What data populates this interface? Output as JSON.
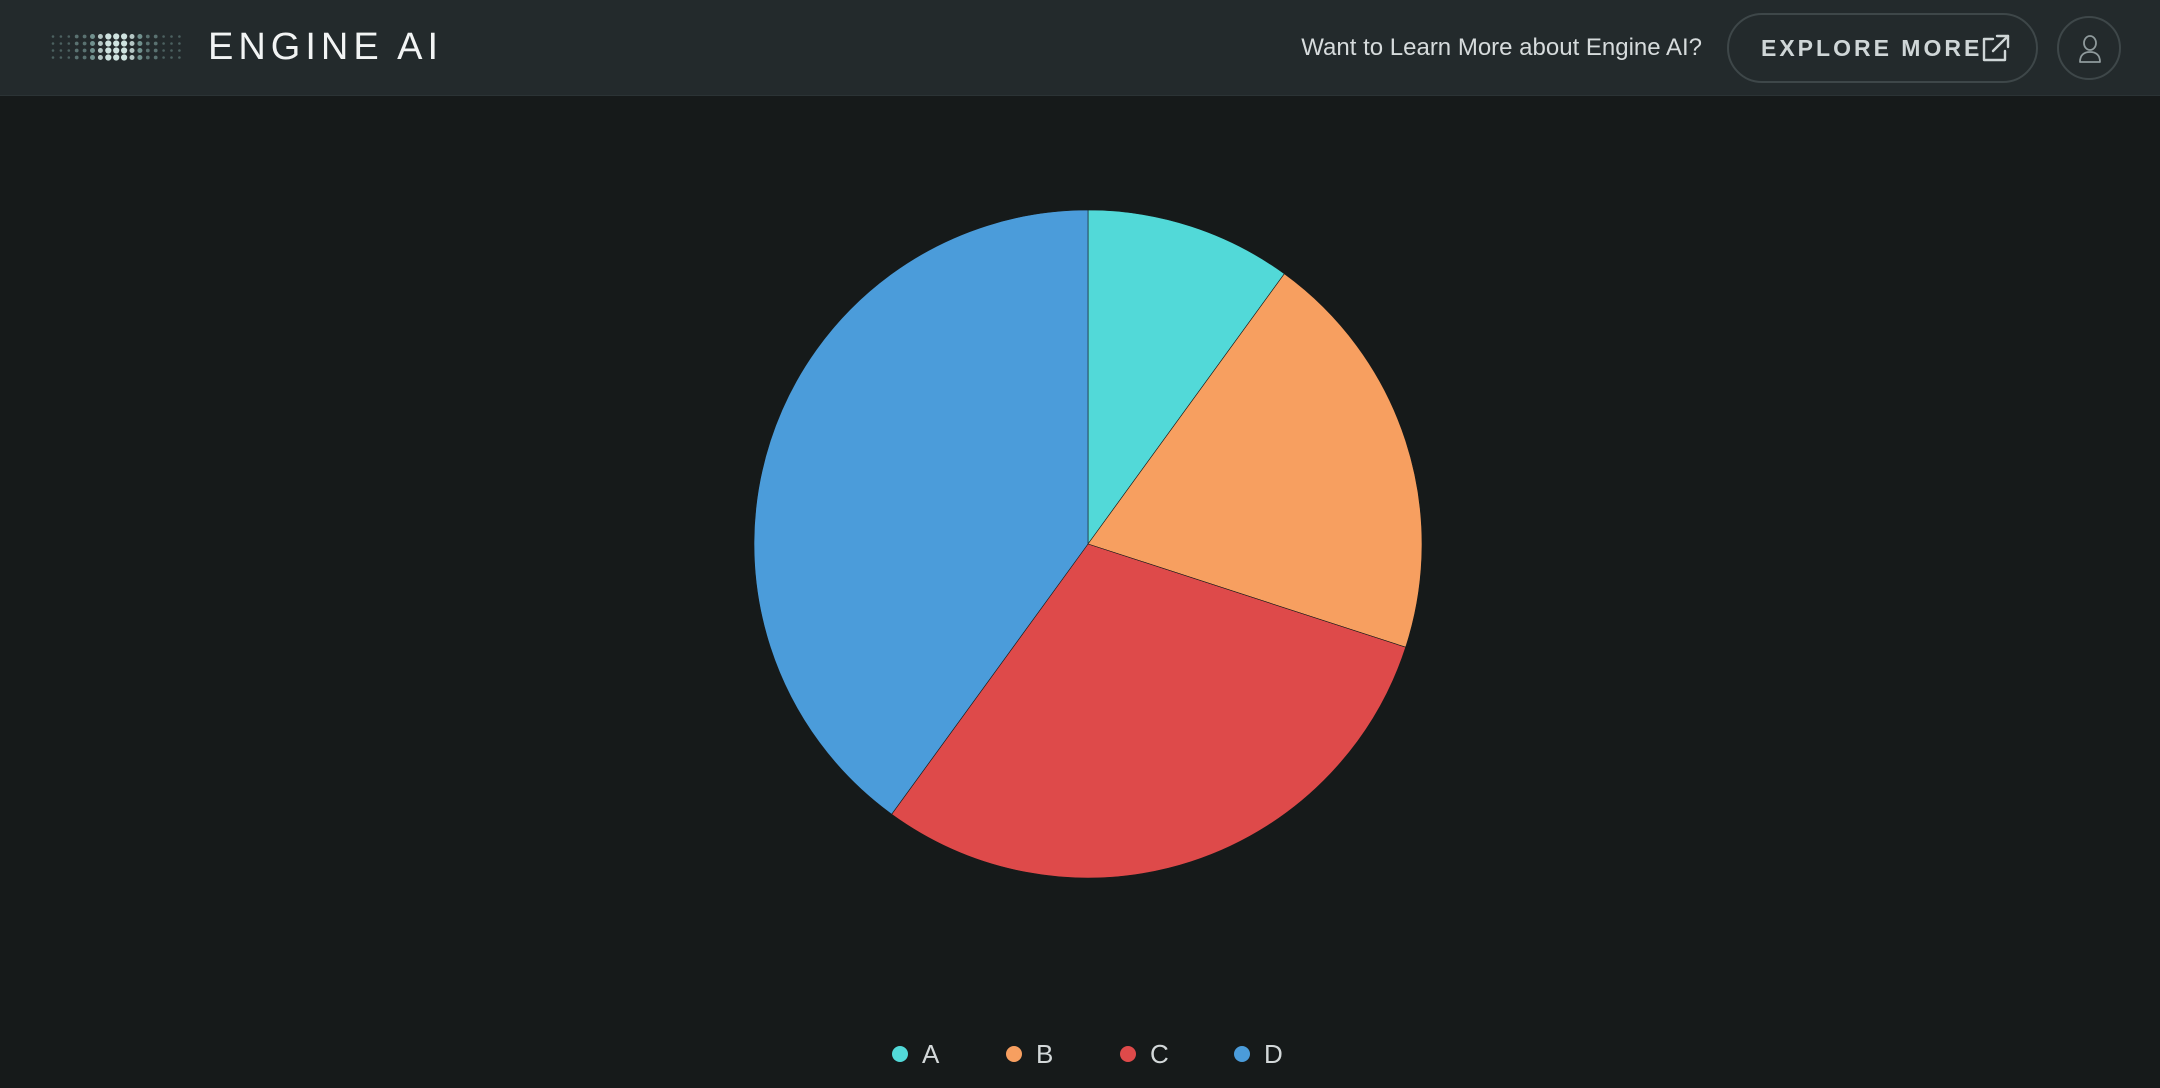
{
  "header": {
    "brand": "ENGINE AI",
    "promo_text": "Want to Learn More about Engine AI?",
    "explore_label": "EXPLORE MORE",
    "explore_icon": "external-link-icon",
    "user_icon": "user-icon",
    "logo_icon": "dot-matrix-logo-icon"
  },
  "colors": {
    "background": "#161a1a",
    "header_bg": "#232a2c",
    "A": "#52d9d8",
    "B": "#f79f60",
    "C": "#de4a4a",
    "D": "#4b9cda"
  },
  "chart_data": {
    "type": "pie",
    "title": "",
    "categories": [
      "A",
      "B",
      "C",
      "D"
    ],
    "values": [
      10,
      20,
      30,
      40
    ],
    "colors": [
      "#52d9d8",
      "#f79f60",
      "#de4a4a",
      "#4b9cda"
    ],
    "start_angle": "top (12 o'clock)",
    "direction": "clockwise",
    "legend": {
      "position": "bottom-center",
      "items": [
        "A",
        "B",
        "C",
        "D"
      ]
    }
  }
}
